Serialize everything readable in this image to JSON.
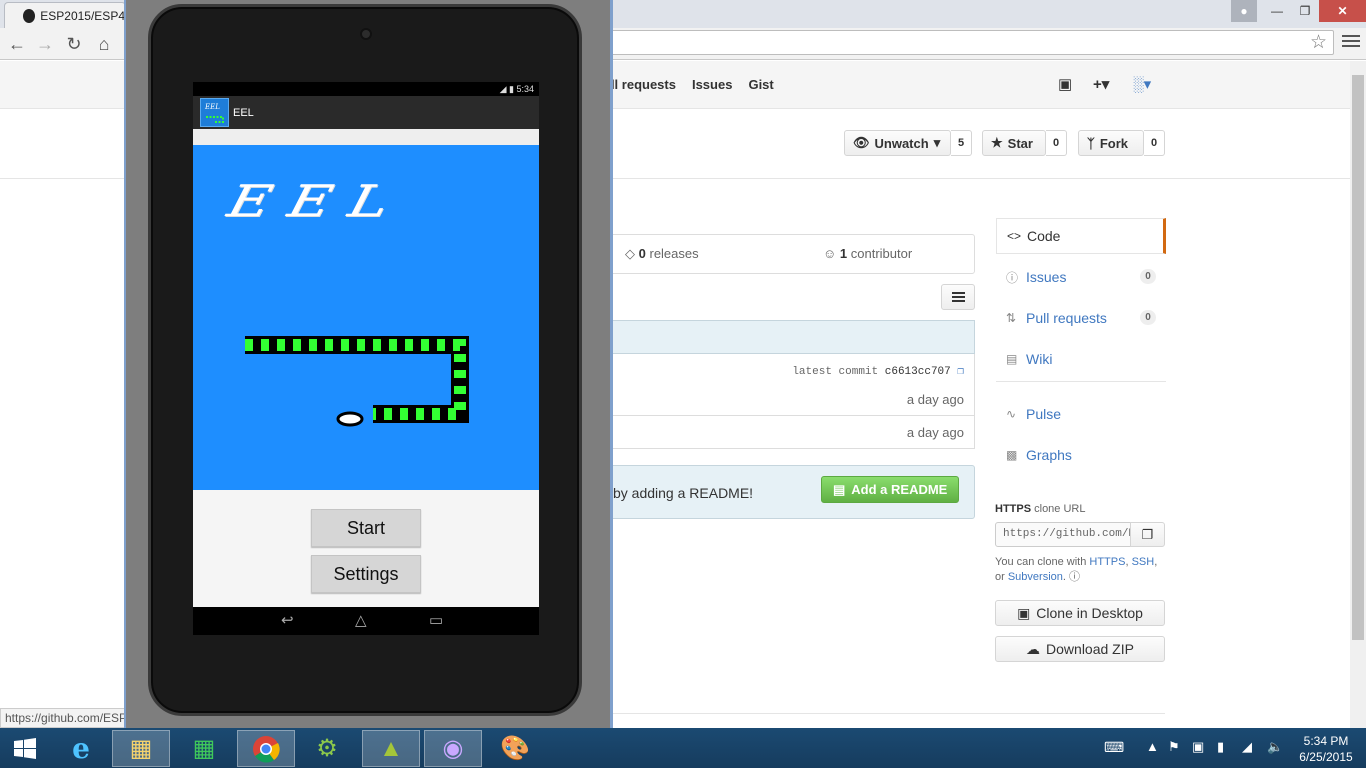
{
  "browser": {
    "tab_title": "ESP2015/ESP4",
    "status_url": "https://github.com/ESP"
  },
  "github": {
    "nav": [
      "ull requests",
      "Issues",
      "Gist"
    ],
    "unwatch": {
      "label": "Unwatch",
      "count": "5"
    },
    "star": {
      "label": "Star",
      "count": "0"
    },
    "fork": {
      "label": "Fork",
      "count": "0"
    },
    "summary": {
      "releases_count": "0",
      "releases_label": "releases",
      "contributors_count": "1",
      "contributors_label": "contributor"
    },
    "latest_commit": {
      "label": "latest commit",
      "sha": "c6613cc707"
    },
    "file_rows": [
      {
        "age": "a day ago"
      },
      {
        "age": "a day ago"
      }
    ],
    "readme": {
      "message": "by adding a README!",
      "button": "Add a README"
    },
    "sidebar": {
      "items": [
        {
          "label": "Code",
          "icon": "code-icon"
        },
        {
          "label": "Issues",
          "icon": "issue-icon",
          "count": "0"
        },
        {
          "label": "Pull requests",
          "icon": "pull-request-icon",
          "count": "0"
        },
        {
          "label": "Wiki",
          "icon": "book-icon"
        },
        {
          "label": "Pulse",
          "icon": "pulse-icon"
        },
        {
          "label": "Graphs",
          "icon": "graph-icon"
        }
      ]
    },
    "clone": {
      "protocol": "HTTPS",
      "label_suffix": "clone URL",
      "url": "https://github.com/E",
      "help_prefix": "You can clone with",
      "help_https": "HTTPS",
      "help_ssh": "SSH",
      "help_or": "or",
      "help_svn": "Subversion",
      "desktop_button": "Clone in Desktop",
      "zip_button": "Download ZIP"
    }
  },
  "emulator": {
    "status_time": "5:34",
    "app_title": "EEL",
    "logo_text": "EEL",
    "buttons": {
      "start": "Start",
      "settings": "Settings"
    }
  },
  "taskbar": {
    "time": "5:34 PM",
    "date": "6/25/2015"
  },
  "colors": {
    "link": "#4078c0",
    "readme_button": "#6cc644",
    "game_background": "#1e8eff",
    "eel_body": "#33ff33",
    "sidebar_selected_accent": "#d26911"
  }
}
